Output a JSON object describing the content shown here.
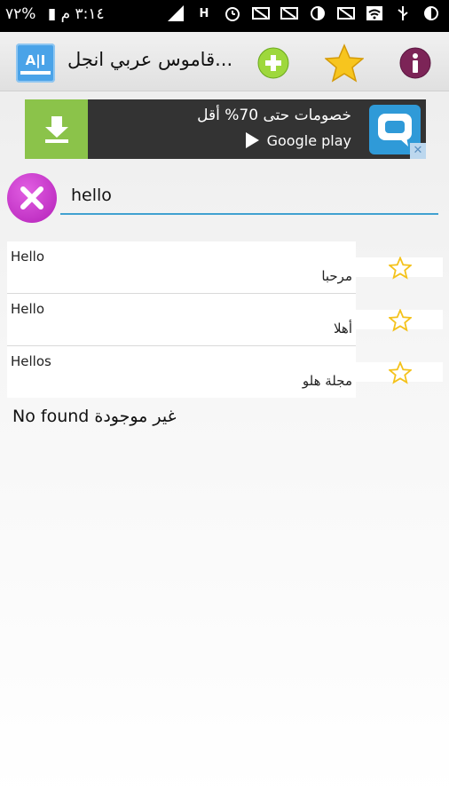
{
  "status_bar": {
    "time": "٣:١٤ م",
    "battery": "%٧٢",
    "network": "H",
    "icons": [
      "battery-icon",
      "signal-icon",
      "network-h-icon",
      "alarm-icon",
      "screenshot-off-icon",
      "screenshot-off-icon",
      "half-circle-icon",
      "screenshot-off-icon",
      "wifi-icon",
      "usb-icon",
      "half-circle-icon"
    ]
  },
  "action_bar": {
    "logo_text": "A|I",
    "title": "قاموس عربي انجل...",
    "add_icon": "plus-circle-icon",
    "favorites_icon": "star-icon",
    "info_icon": "info-icon"
  },
  "ad": {
    "headline": "خصومات حتى 70% أقل",
    "store": "Google play",
    "download_icon": "download-icon",
    "app_icon": "chat-bubble-icon",
    "close_icon": "close-icon"
  },
  "search": {
    "value": "hello",
    "clear_icon": "close-icon"
  },
  "results": [
    {
      "en": "Hello",
      "ar": "مرحبا"
    },
    {
      "en": "Hello",
      "ar": "أهلا"
    },
    {
      "en": "Hellos",
      "ar": "مجلة هلو"
    }
  ],
  "no_found": "No found غير موجودة",
  "colors": {
    "accent": "#41a1d1",
    "clear_button": "#c12fc6",
    "star": "#f4c21b",
    "ad_green": "#8bc34a"
  }
}
